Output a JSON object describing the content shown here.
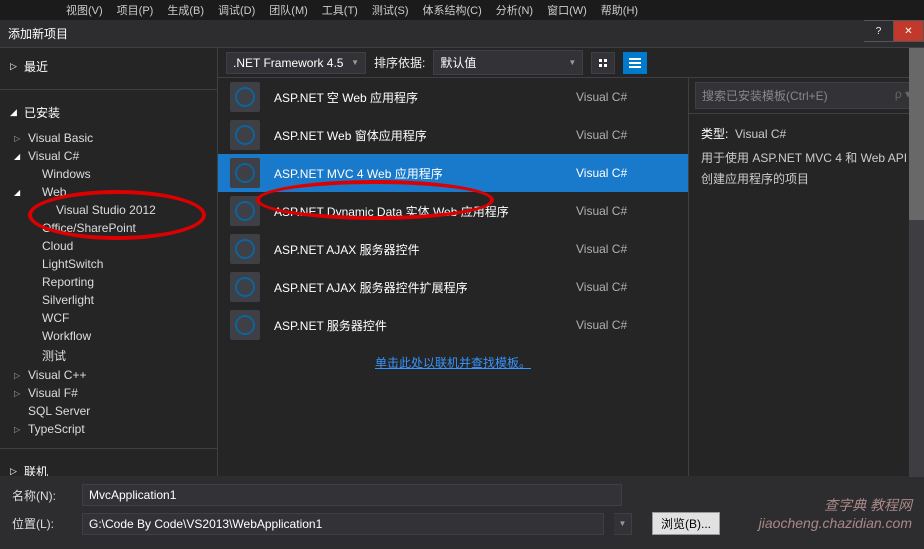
{
  "menubar": [
    "视图(V)",
    "项目(P)",
    "生成(B)",
    "调试(D)",
    "团队(M)",
    "工具(T)",
    "测试(S)",
    "体系结构(C)",
    "分析(N)",
    "窗口(W)",
    "帮助(H)"
  ],
  "window": {
    "title": "添加新项目",
    "help": "?",
    "close": "✕"
  },
  "sidebar": {
    "recent": "最近",
    "installed": "已安装",
    "online": "联机",
    "tree": {
      "vb": "Visual Basic",
      "cs": "Visual C#",
      "windows": "Windows",
      "web": "Web",
      "vs2012": "Visual Studio 2012",
      "sharepoint": "Office/SharePoint",
      "cloud": "Cloud",
      "lightswitch": "LightSwitch",
      "reporting": "Reporting",
      "silverlight": "Silverlight",
      "wcf": "WCF",
      "workflow": "Workflow",
      "test": "测试",
      "cpp": "Visual C++",
      "fs": "Visual F#",
      "sql": "SQL Server",
      "ts": "TypeScript"
    }
  },
  "toolbar": {
    "framework": ".NET Framework 4.5",
    "sort_label": "排序依据:",
    "sort_value": "默认值"
  },
  "search": {
    "placeholder": "搜索已安装模板(Ctrl+E)",
    "icon": "🔍"
  },
  "templates": [
    {
      "name": "ASP.NET 空 Web 应用程序",
      "lang": "Visual C#"
    },
    {
      "name": "ASP.NET Web 窗体应用程序",
      "lang": "Visual C#"
    },
    {
      "name": "ASP.NET MVC 4 Web 应用程序",
      "lang": "Visual C#"
    },
    {
      "name": "ASP.NET Dynamic Data 实体 Web 应用程序",
      "lang": "Visual C#"
    },
    {
      "name": "ASP.NET AJAX 服务器控件",
      "lang": "Visual C#"
    },
    {
      "name": "ASP.NET AJAX 服务器控件扩展程序",
      "lang": "Visual C#"
    },
    {
      "name": "ASP.NET 服务器控件",
      "lang": "Visual C#"
    }
  ],
  "link": "单击此处以联机并查找模板。",
  "details": {
    "type_label": "类型:",
    "type_value": "Visual C#",
    "desc": "用于使用 ASP.NET MVC 4 和 Web API 创建应用程序的项目"
  },
  "form": {
    "name_label": "名称(N):",
    "name_value": "MvcApplication1",
    "location_label": "位置(L):",
    "location_value": "G:\\Code By Code\\VS2013\\WebApplication1",
    "browse": "浏览(B)..."
  },
  "watermark": "查字典 教程网\njiaocheng.chazidian.com"
}
